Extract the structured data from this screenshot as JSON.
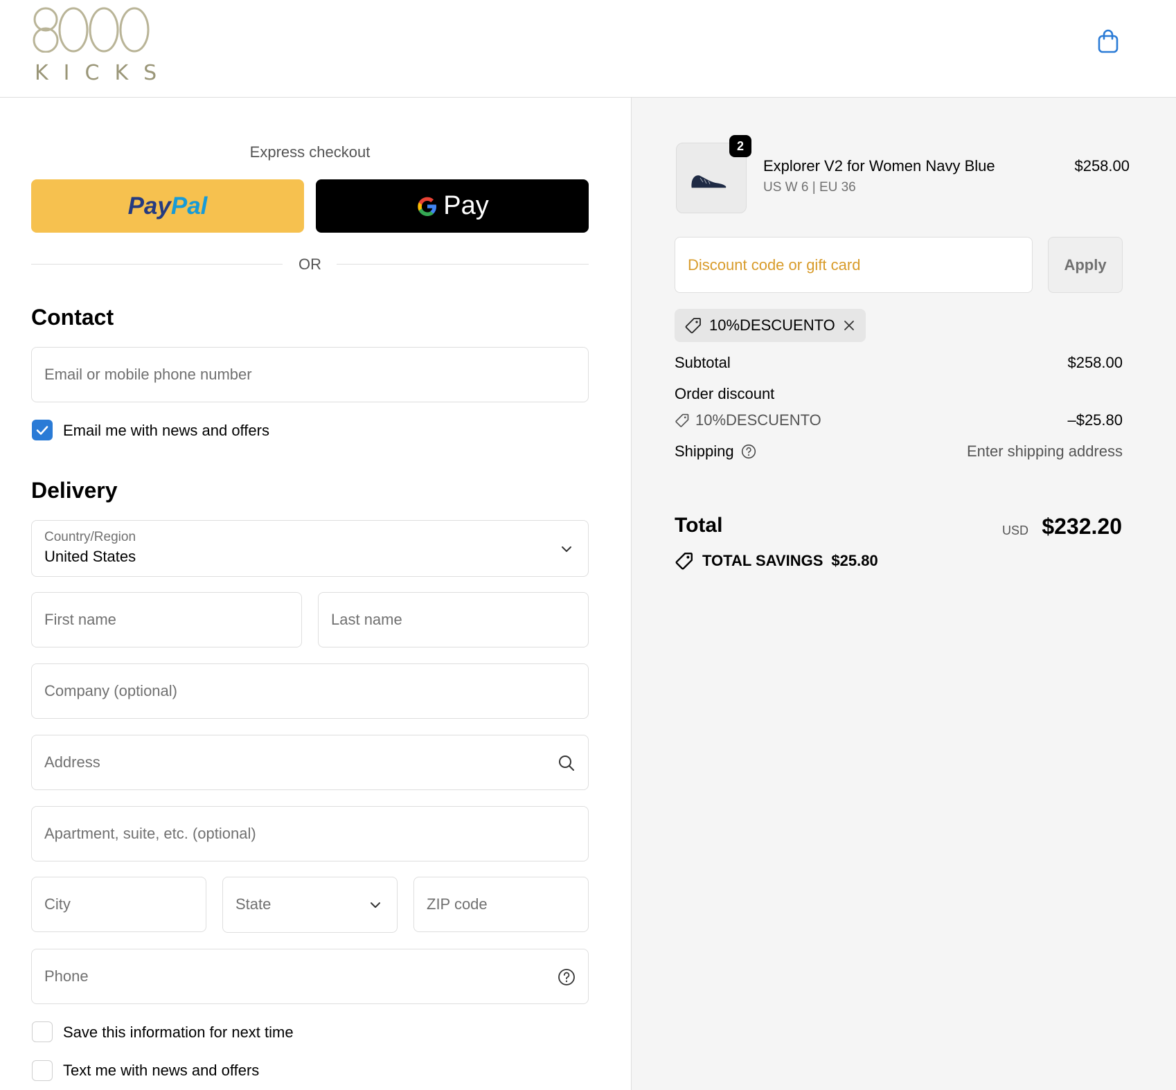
{
  "header": {
    "logo_number": "8000",
    "logo_word": "KICKS",
    "cart_icon": "shopping-bag-icon"
  },
  "express": {
    "title": "Express checkout",
    "paypal_part1": "Pay",
    "paypal_part2": "Pal",
    "gpay_label": "Pay",
    "or_label": "OR"
  },
  "contact": {
    "title": "Contact",
    "email_placeholder": "Email or mobile phone number",
    "news_checkbox_label": "Email me with news and offers",
    "news_checked": true
  },
  "delivery": {
    "title": "Delivery",
    "country_label": "Country/Region",
    "country_value": "United States",
    "first_name_placeholder": "First name",
    "last_name_placeholder": "Last name",
    "company_placeholder": "Company (optional)",
    "address_placeholder": "Address",
    "apartment_placeholder": "Apartment, suite, etc. (optional)",
    "city_placeholder": "City",
    "state_placeholder": "State",
    "zip_placeholder": "ZIP code",
    "phone_placeholder": "Phone",
    "save_info_label": "Save this information for next time",
    "text_me_label": "Text me with news and offers"
  },
  "summary": {
    "product": {
      "quantity": "2",
      "name": "Explorer V2 for Women Navy Blue",
      "variant": "US W 6 | EU 36",
      "price": "$258.00"
    },
    "discount_placeholder": "Discount code or gift card",
    "apply_label": "Apply",
    "applied_code": "10%DESCUENTO",
    "subtotal_label": "Subtotal",
    "subtotal_value": "$258.00",
    "order_discount_label": "Order discount",
    "discount_code": "10%DESCUENTO",
    "discount_value": "–$25.80",
    "shipping_label": "Shipping",
    "shipping_value": "Enter shipping address",
    "total_label": "Total",
    "currency": "USD",
    "total_value": "$232.20",
    "savings_label": "TOTAL SAVINGS",
    "savings_value": "$25.80"
  },
  "colors": {
    "paypal_yellow": "#f6c14f",
    "checkbox_blue": "#2a7bd6",
    "discount_placeholder": "#d89b2a"
  }
}
